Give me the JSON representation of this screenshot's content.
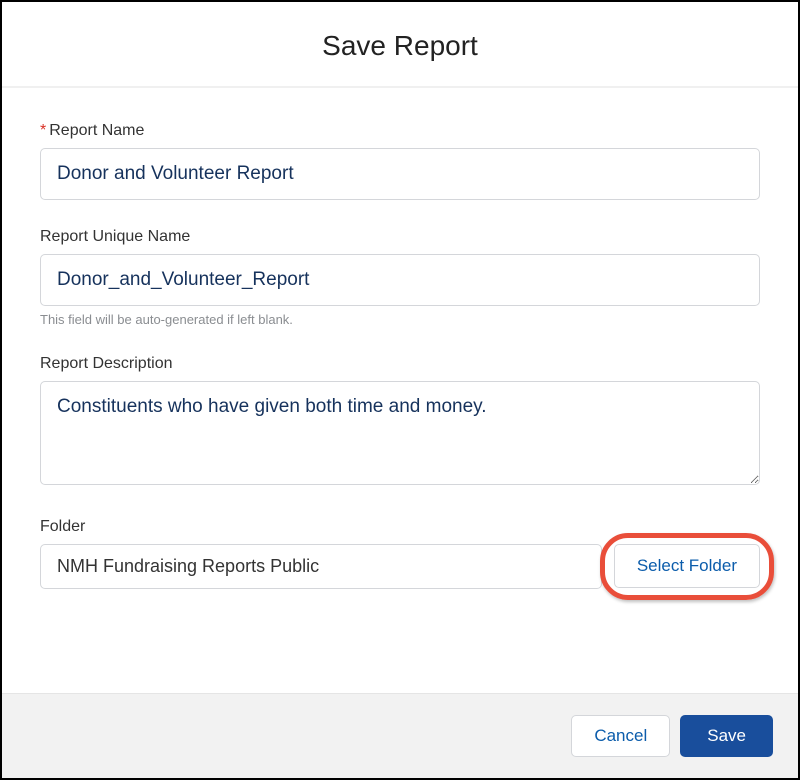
{
  "modal": {
    "title": "Save Report"
  },
  "fields": {
    "reportName": {
      "label": "Report Name",
      "value": "Donor and Volunteer Report",
      "required": true
    },
    "reportUniqueName": {
      "label": "Report Unique Name",
      "value": "Donor_and_Volunteer_Report",
      "helpText": "This field will be auto-generated if left blank."
    },
    "reportDescription": {
      "label": "Report Description",
      "value": "Constituents who have given both time and money."
    },
    "folder": {
      "label": "Folder",
      "value": "NMH Fundraising Reports Public",
      "selectButton": "Select Folder"
    }
  },
  "footer": {
    "cancel": "Cancel",
    "save": "Save"
  }
}
